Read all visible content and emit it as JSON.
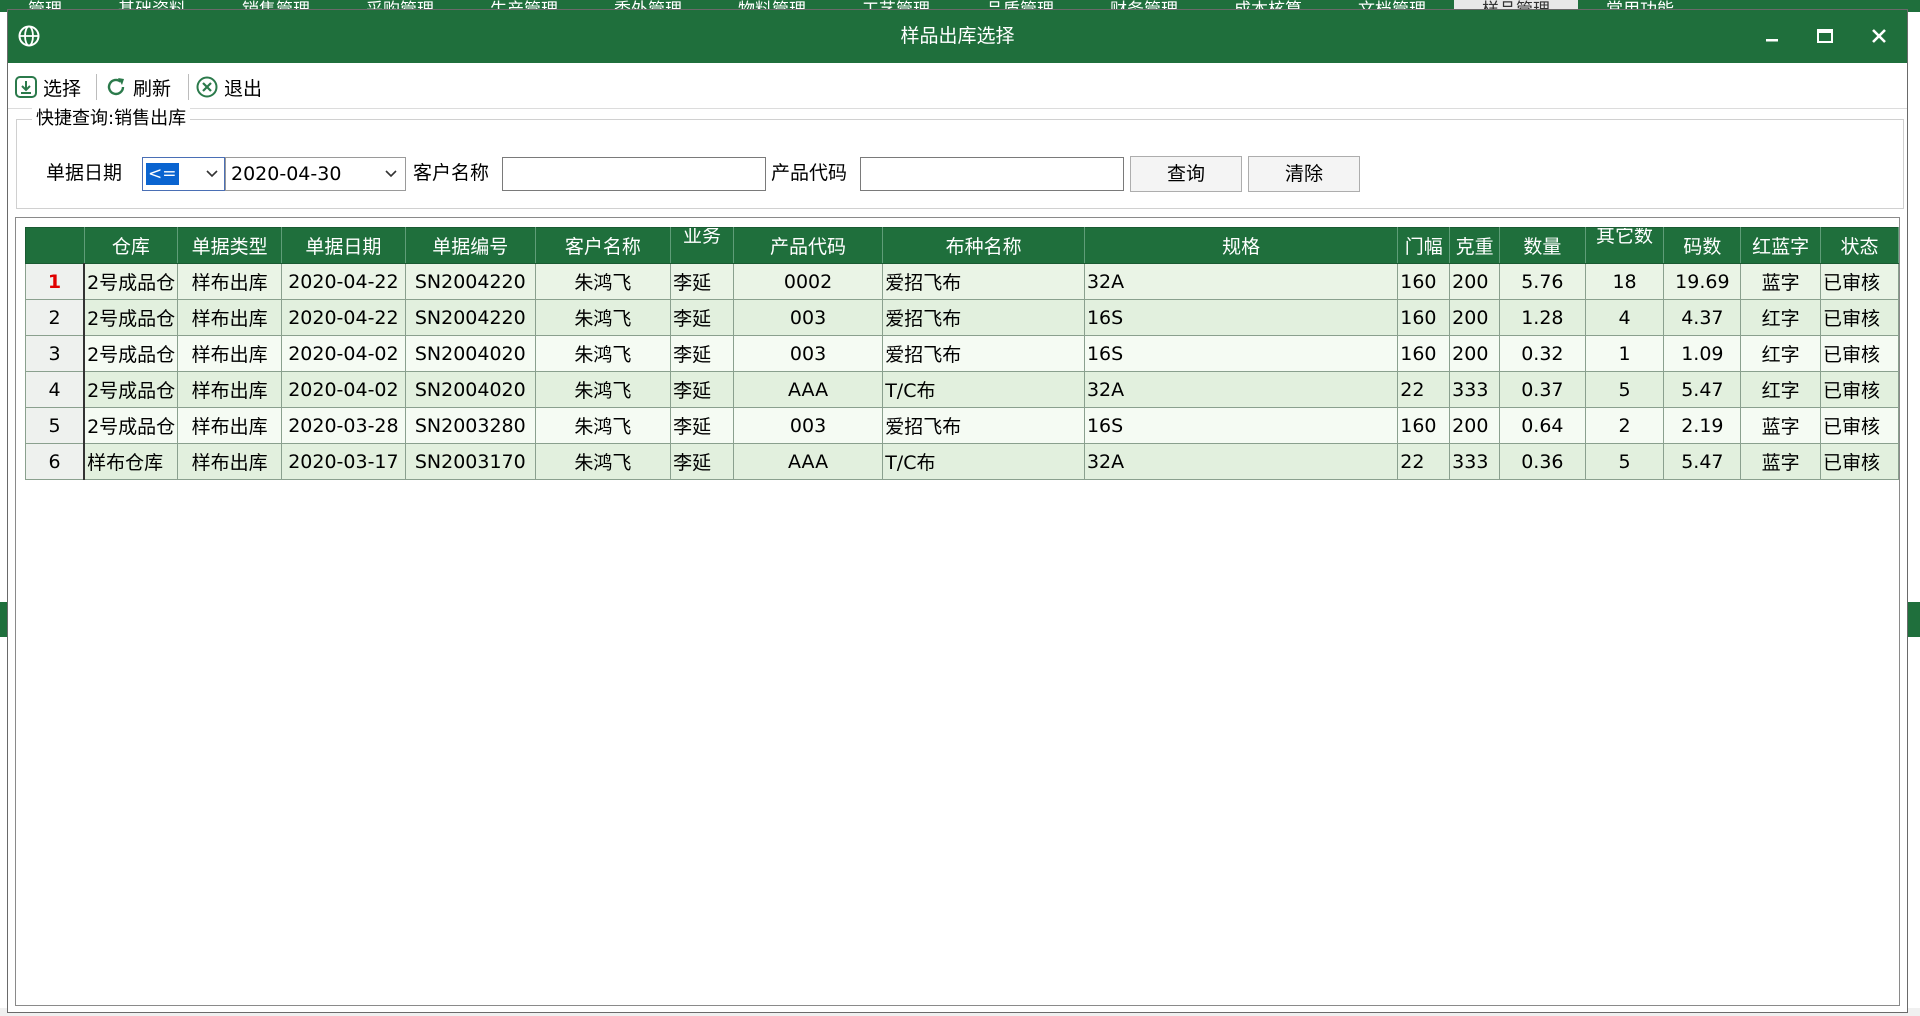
{
  "window": {
    "title": "样品出库选择"
  },
  "toolbar": {
    "select_label": "选择",
    "refresh_label": "刷新",
    "exit_label": "退出"
  },
  "quick": {
    "legend": "快捷查询:销售出库",
    "date_label": "单据日期",
    "operator": "<=",
    "date_value": "2020-04-30",
    "customer_label": "客户名称",
    "customer_value": "",
    "product_label": "产品代码",
    "product_value": "",
    "query_button": "查询",
    "clear_button": "清除"
  },
  "grid": {
    "columns": [
      "仓库",
      "单据类型",
      "单据日期",
      "单据编号",
      "客户名称",
      "业务",
      "产品代码",
      "布种名称",
      "规格",
      "门幅",
      "克重",
      "数量",
      "其它数",
      "码数",
      "红蓝字",
      "状态"
    ],
    "rows": [
      [
        "1",
        "2号成品仓",
        "样布出库",
        "2020-04-22",
        "SN2004220",
        "朱鸿飞",
        "李延",
        "0002",
        "爱招飞布",
        "32A",
        "160",
        "200",
        "5.76",
        "18",
        "19.69",
        "蓝字",
        "已审核"
      ],
      [
        "2",
        "2号成品仓",
        "样布出库",
        "2020-04-22",
        "SN2004220",
        "朱鸿飞",
        "李延",
        "003",
        "爱招飞布",
        "16S",
        "160",
        "200",
        "1.28",
        "4",
        "4.37",
        "红字",
        "已审核"
      ],
      [
        "3",
        "2号成品仓",
        "样布出库",
        "2020-04-02",
        "SN2004020",
        "朱鸿飞",
        "李延",
        "003",
        "爱招飞布",
        "16S",
        "160",
        "200",
        "0.32",
        "1",
        "1.09",
        "红字",
        "已审核"
      ],
      [
        "4",
        "2号成品仓",
        "样布出库",
        "2020-04-02",
        "SN2004020",
        "朱鸿飞",
        "李延",
        "AAA",
        "T/C布",
        "32A",
        "22",
        "333",
        "0.37",
        "5",
        "5.47",
        "红字",
        "已审核"
      ],
      [
        "5",
        "2号成品仓",
        "样布出库",
        "2020-03-28",
        "SN2003280",
        "朱鸿飞",
        "李延",
        "003",
        "爱招飞布",
        "16S",
        "160",
        "200",
        "0.64",
        "2",
        "2.19",
        "蓝字",
        "已审核"
      ],
      [
        "6",
        "样布仓库",
        "样布出库",
        "2020-03-17",
        "SN2003170",
        "朱鸿飞",
        "李延",
        "AAA",
        "T/C布",
        "32A",
        "22",
        "333",
        "0.36",
        "5",
        "5.47",
        "蓝字",
        "已审核"
      ]
    ]
  },
  "background_menu": [
    "管理",
    "基础资料",
    "销售管理",
    "采购管理",
    "生产管理",
    "委外管理",
    "物料管理",
    "工艺管理",
    "品质管理",
    "财务管理",
    "成本核算",
    "文档管理",
    "样品管理",
    "常用功能"
  ],
  "icons": {
    "app": "globe-icon",
    "minimize": "minimize-icon",
    "maximize": "maximize-icon",
    "close": "close-icon",
    "select": "download-icon",
    "refresh": "refresh-icon",
    "exit": "cancel-circle-icon"
  },
  "colors": {
    "accent": "#1f6f3c",
    "selection": "#0a64d0",
    "row_number_active": "#e00000"
  }
}
